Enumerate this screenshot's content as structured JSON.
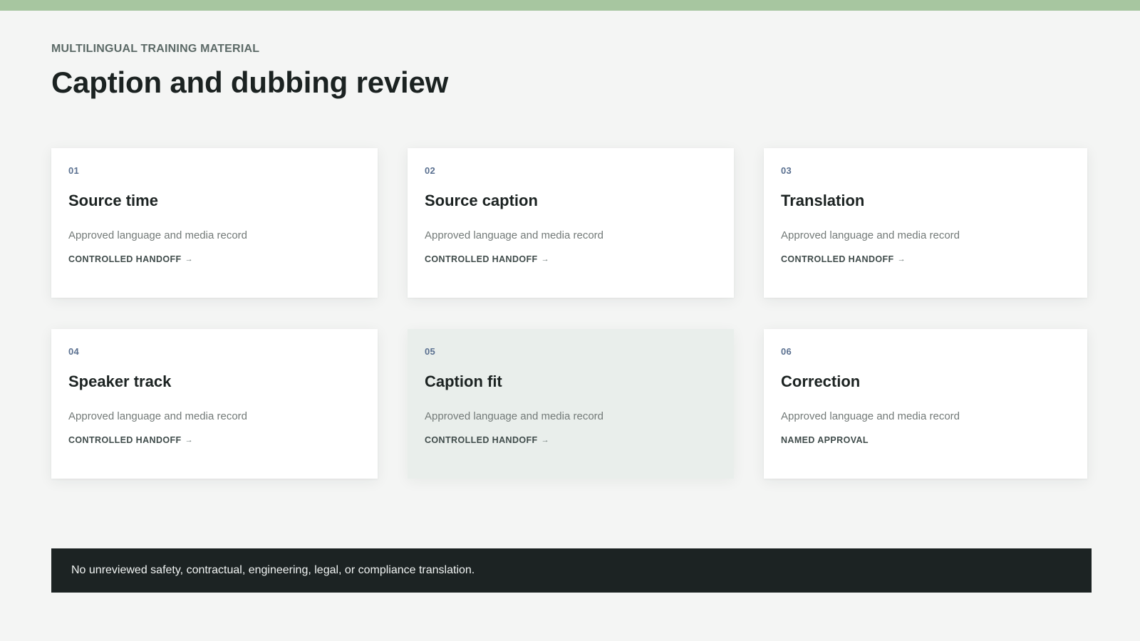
{
  "header": {
    "eyebrow": "MULTILINGUAL TRAINING MATERIAL",
    "title": "Caption and dubbing review"
  },
  "cards": [
    {
      "num": "01",
      "title": "Source time",
      "desc": "Approved language and media record",
      "action": "CONTROLLED HANDOFF",
      "arrow": "→"
    },
    {
      "num": "02",
      "title": "Source caption",
      "desc": "Approved language and media record",
      "action": "CONTROLLED HANDOFF",
      "arrow": "→"
    },
    {
      "num": "03",
      "title": "Translation",
      "desc": "Approved language and media record",
      "action": "CONTROLLED HANDOFF",
      "arrow": "→"
    },
    {
      "num": "04",
      "title": "Speaker track",
      "desc": "Approved language and media record",
      "action": "CONTROLLED HANDOFF",
      "arrow": "→"
    },
    {
      "num": "05",
      "title": "Caption fit",
      "desc": "Approved language and media record",
      "action": "CONTROLLED HANDOFF",
      "arrow": "→"
    },
    {
      "num": "06",
      "title": "Correction",
      "desc": "Approved language and media record",
      "action": "NAMED APPROVAL",
      "arrow": ""
    }
  ],
  "footer": {
    "notice": "No unreviewed safety, contractual, engineering, legal, or compliance translation."
  },
  "colors": {
    "accent_bar": "#a7c6a0",
    "background": "#f4f5f4",
    "card_highlight": "#e9eeeb",
    "banner": "#1c2323"
  }
}
